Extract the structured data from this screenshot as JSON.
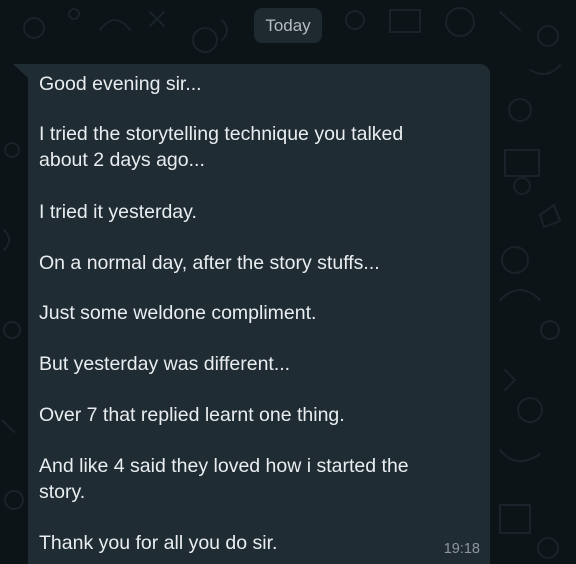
{
  "chat": {
    "date_label": "Today",
    "message": {
      "paragraphs": [
        "Good evening sir...",
        "I tried the storytelling technique you talked\nabout 2 days ago...",
        "I tried it yesterday.",
        "On a normal day, after the story stuffs...",
        "Just some weldone compliment.",
        "But yesterday was different...",
        "Over 7 that replied learnt one thing.",
        "And like 4 said they loved how i started the\nstory.",
        "Thank you for all you do sir."
      ],
      "time": "19:18"
    }
  },
  "colors": {
    "background": "#0d1418",
    "bubble": "#1f2c34",
    "text": "#e9edef",
    "meta": "#8d979d"
  }
}
